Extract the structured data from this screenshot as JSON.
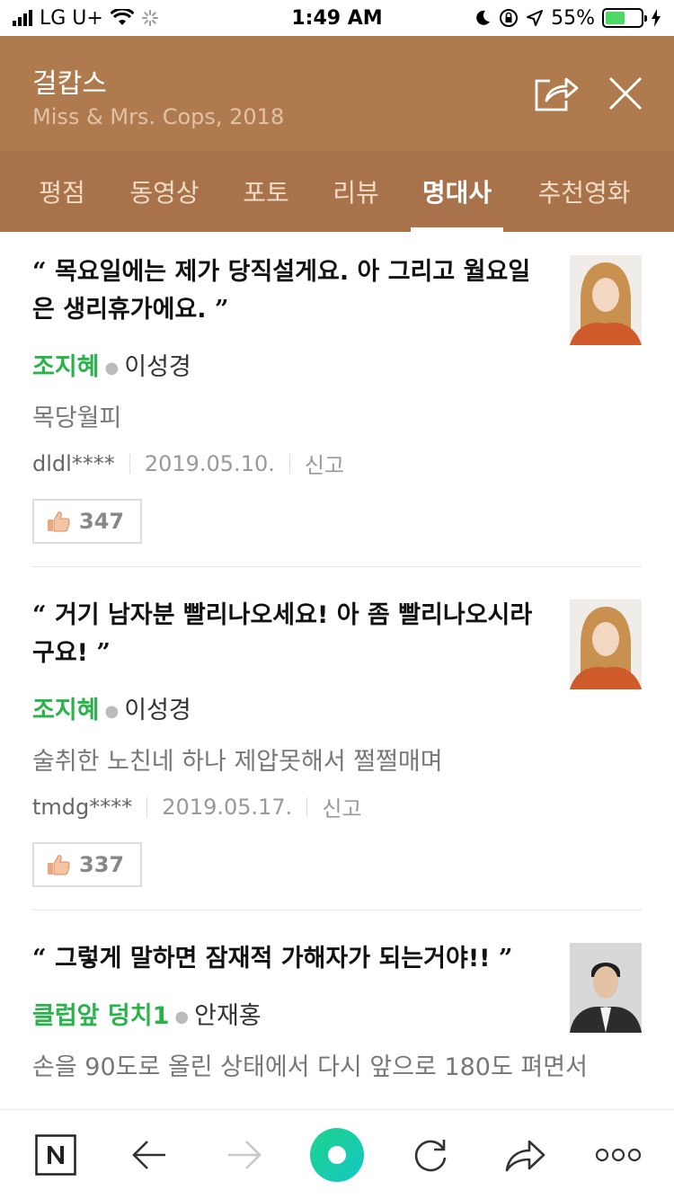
{
  "status": {
    "carrier": "LG U+",
    "time": "1:49 AM",
    "battery": "55%"
  },
  "header": {
    "title": "걸캅스",
    "subtitle": "Miss & Mrs. Cops, 2018",
    "share_icon": "share-icon",
    "close_icon": "close-icon"
  },
  "tabs": [
    {
      "label": "평점"
    },
    {
      "label": "동영상"
    },
    {
      "label": "포토"
    },
    {
      "label": "리뷰"
    },
    {
      "label": "명대사",
      "active": true
    },
    {
      "label": "추천영화"
    }
  ],
  "quotes": [
    {
      "open": "“",
      "text": "목요일에는 제가 당직설게요. 아 그리고 월요일은 생리휴가에요.",
      "close": "”",
      "role": "조지혜",
      "actor": "이성경",
      "description": "목당월피",
      "user": "dldl****",
      "date": "2019.05.10.",
      "report": "신고",
      "likes": "347"
    },
    {
      "open": "“",
      "text": "거기 남자분 빨리나오세요! 아 좀 빨리나오시라구요!",
      "close": "”",
      "role": "조지혜",
      "actor": "이성경",
      "description": "술취한 노친네 하나 제압못해서 쩔쩔매며",
      "user": "tmdg****",
      "date": "2019.05.17.",
      "report": "신고",
      "likes": "337"
    },
    {
      "open": "“",
      "text": "그렇게 말하면 잠재적 가해자가 되는거야!!",
      "close": "”",
      "role": "클럽앞 덩치1",
      "actor": "안재홍",
      "description": "손을 90도로 올린 상태에서 다시 앞으로 180도 펴면서"
    }
  ],
  "bottom_bar": [
    "naver-icon",
    "back-arrow-icon",
    "forward-arrow-icon",
    "home-circle-icon",
    "refresh-icon",
    "share-arrow-icon",
    "more-icon"
  ],
  "colors": {
    "header_bg": "#b07a4f",
    "tabs_bg": "#a8724a",
    "role_green": "#2bb34b",
    "home_green": "#1ed3a0"
  }
}
